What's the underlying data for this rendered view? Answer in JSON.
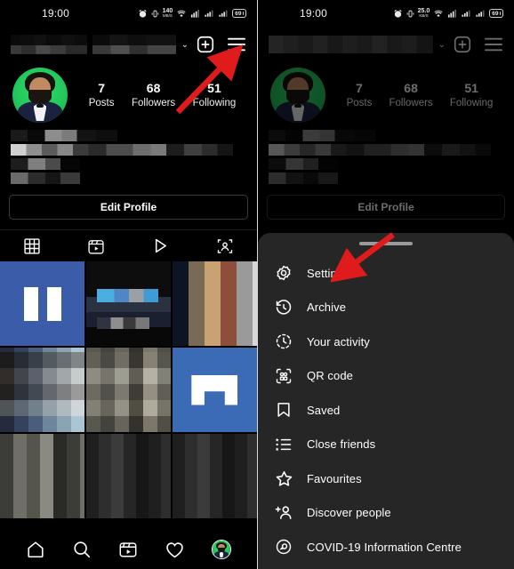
{
  "meta": {
    "accent_red": "#e01b1b",
    "sheet_bg": "#262626",
    "screen_bg": "#000000",
    "avatar_ring": "#22c55e"
  },
  "left": {
    "status": {
      "time": "19:00",
      "net_speed_value": "140",
      "net_speed_unit": "MB/S",
      "battery": "69"
    },
    "header": {
      "chevron": "⌄",
      "add_icon": "plus-circle",
      "menu_icon": "hamburger"
    },
    "stats": [
      {
        "num": "7",
        "label": "Posts"
      },
      {
        "num": "68",
        "label": "Followers"
      },
      {
        "num": "51",
        "label": "Following"
      }
    ],
    "edit_profile": "Edit Profile",
    "tabs": [
      {
        "name": "grid",
        "active": true
      },
      {
        "name": "reels",
        "active": false
      },
      {
        "name": "video",
        "active": false
      },
      {
        "name": "tagged",
        "active": false
      }
    ],
    "bottom_nav": [
      {
        "name": "home"
      },
      {
        "name": "search"
      },
      {
        "name": "reels"
      },
      {
        "name": "activity"
      },
      {
        "name": "profile"
      }
    ]
  },
  "right": {
    "status": {
      "time": "19:00",
      "net_speed_value": "25.0",
      "net_speed_unit": "KB/S",
      "battery": "69"
    },
    "stats": [
      {
        "num": "7",
        "label": "Posts"
      },
      {
        "num": "68",
        "label": "Followers"
      },
      {
        "num": "51",
        "label": "Following"
      }
    ],
    "edit_profile": "Edit Profile",
    "sheet": {
      "items": [
        {
          "icon": "gear-icon",
          "label": "Settings"
        },
        {
          "icon": "archive-clock-icon",
          "label": "Archive"
        },
        {
          "icon": "your-activity-clock-icon",
          "label": "Your activity"
        },
        {
          "icon": "qr-code-icon",
          "label": "QR code"
        },
        {
          "icon": "bookmark-icon",
          "label": "Saved"
        },
        {
          "icon": "close-friends-list-icon",
          "label": "Close friends"
        },
        {
          "icon": "star-icon",
          "label": "Favourites"
        },
        {
          "icon": "add-person-icon",
          "label": "Discover people"
        },
        {
          "icon": "covid-info-icon",
          "label": "COVID-19 Information Centre"
        }
      ]
    }
  }
}
